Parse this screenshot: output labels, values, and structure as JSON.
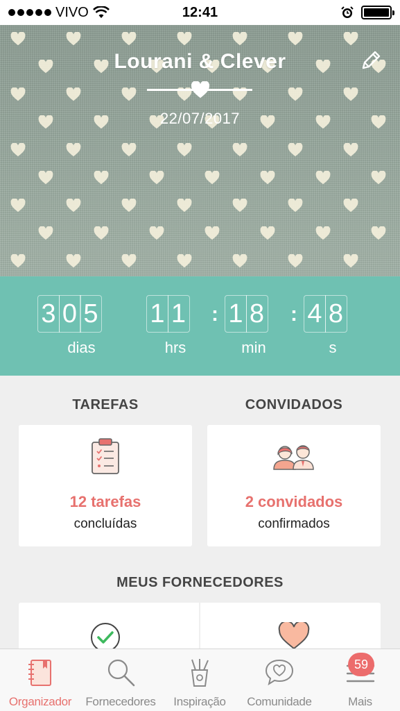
{
  "status_bar": {
    "carrier": "VIVO",
    "time": "12:41"
  },
  "header": {
    "couple_names": "Lourani & Clever",
    "wedding_date": "22/07/2017"
  },
  "countdown": {
    "days": [
      "3",
      "0",
      "5"
    ],
    "hours": [
      "1",
      "1"
    ],
    "minutes": [
      "1",
      "8"
    ],
    "seconds": [
      "4",
      "8"
    ],
    "labels": {
      "days": "dias",
      "hours": "hrs",
      "minutes": "min",
      "seconds": "s"
    }
  },
  "tasks": {
    "title": "TAREFAS",
    "count": "12 tarefas",
    "subtitle": "concluídas"
  },
  "guests": {
    "title": "CONVIDADOS",
    "count": "2 convidados",
    "subtitle": "confirmados"
  },
  "vendors": {
    "title": "MEUS FORNECEDORES"
  },
  "tab_bar": {
    "items": [
      {
        "label": "Organizador",
        "icon": "notebook-icon",
        "active": true
      },
      {
        "label": "Fornecedores",
        "icon": "search-icon",
        "active": false
      },
      {
        "label": "Inspiração",
        "icon": "pencil-cup-icon",
        "active": false
      },
      {
        "label": "Comunidade",
        "icon": "chat-heart-icon",
        "active": false
      },
      {
        "label": "Mais",
        "icon": "menu-icon",
        "active": false
      }
    ],
    "more_badge": "59"
  },
  "colors": {
    "accent": "#e7716e",
    "teal": "#6fc1b2",
    "hero_green": "#97a89e",
    "heart_cream": "#f3efdb"
  }
}
